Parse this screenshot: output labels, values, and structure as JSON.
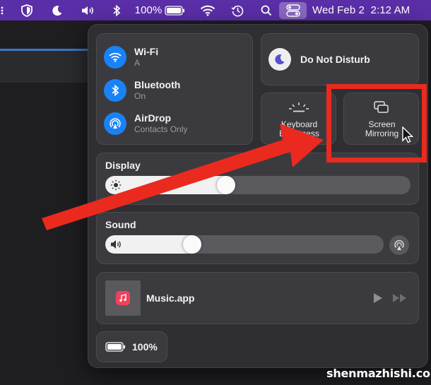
{
  "menubar": {
    "battery_percent": "100%",
    "datetime": "Wed Feb 2  2:12 AM"
  },
  "connectivity": {
    "wifi": {
      "title": "Wi-Fi",
      "subtitle": "A"
    },
    "bluetooth": {
      "title": "Bluetooth",
      "subtitle": "On"
    },
    "airdrop": {
      "title": "AirDrop",
      "subtitle": "Contacts Only"
    }
  },
  "focus": {
    "label": "Do Not Disturb"
  },
  "keyboard_brightness": {
    "line1": "Keyboard",
    "line2": "Brightness"
  },
  "screen_mirroring": {
    "line1": "Screen",
    "line2": "Mirroring"
  },
  "display": {
    "title": "Display",
    "level": 0.39
  },
  "sound": {
    "title": "Sound",
    "level": 0.3
  },
  "now_playing": {
    "app": "Music.app"
  },
  "battery_module": {
    "percent": "100%"
  },
  "watermark": "shenmazhishi.com",
  "colors": {
    "menubar": "#5a2ea6",
    "accent_blue": "#1a82f7",
    "highlight_red": "#ea2a1f",
    "music_red": "#f1425b"
  }
}
